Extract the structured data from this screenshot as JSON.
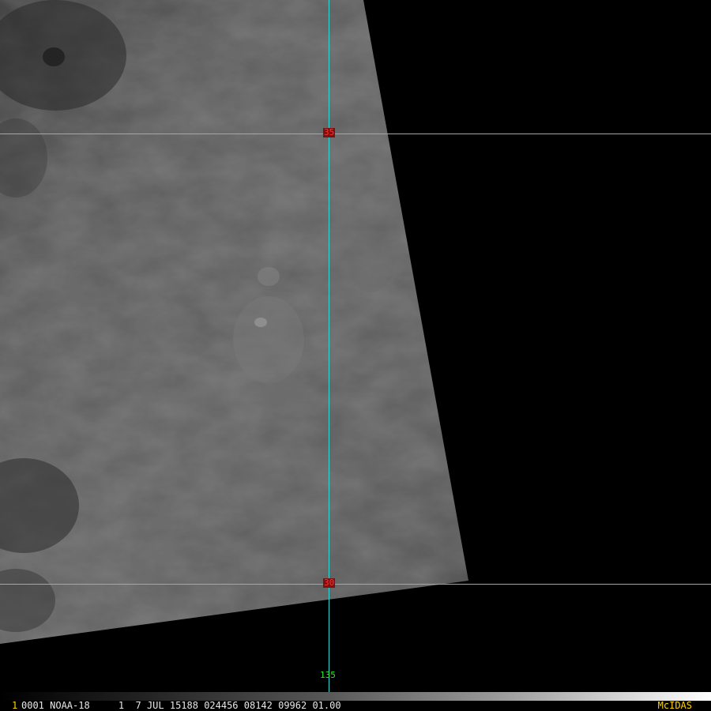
{
  "image": {
    "satellite_swath": "grayscale satellite visible image swath",
    "grid_color": "#35d6d6",
    "lat_label_color": "#ff3030",
    "lon_label_color": "#22ee22"
  },
  "grid": {
    "lat_labels": [
      {
        "name": "lat-line-upper",
        "text": "35"
      },
      {
        "name": "lat-line-lower",
        "text": "30"
      }
    ],
    "lon_labels": [
      {
        "name": "lon-line-main",
        "text": "135"
      }
    ]
  },
  "status": {
    "frame_number": "1",
    "line": "0001 NOAA-18     1  7 JUL 15188 024456 08142 09962 01.00",
    "brand": "McIDAS"
  }
}
